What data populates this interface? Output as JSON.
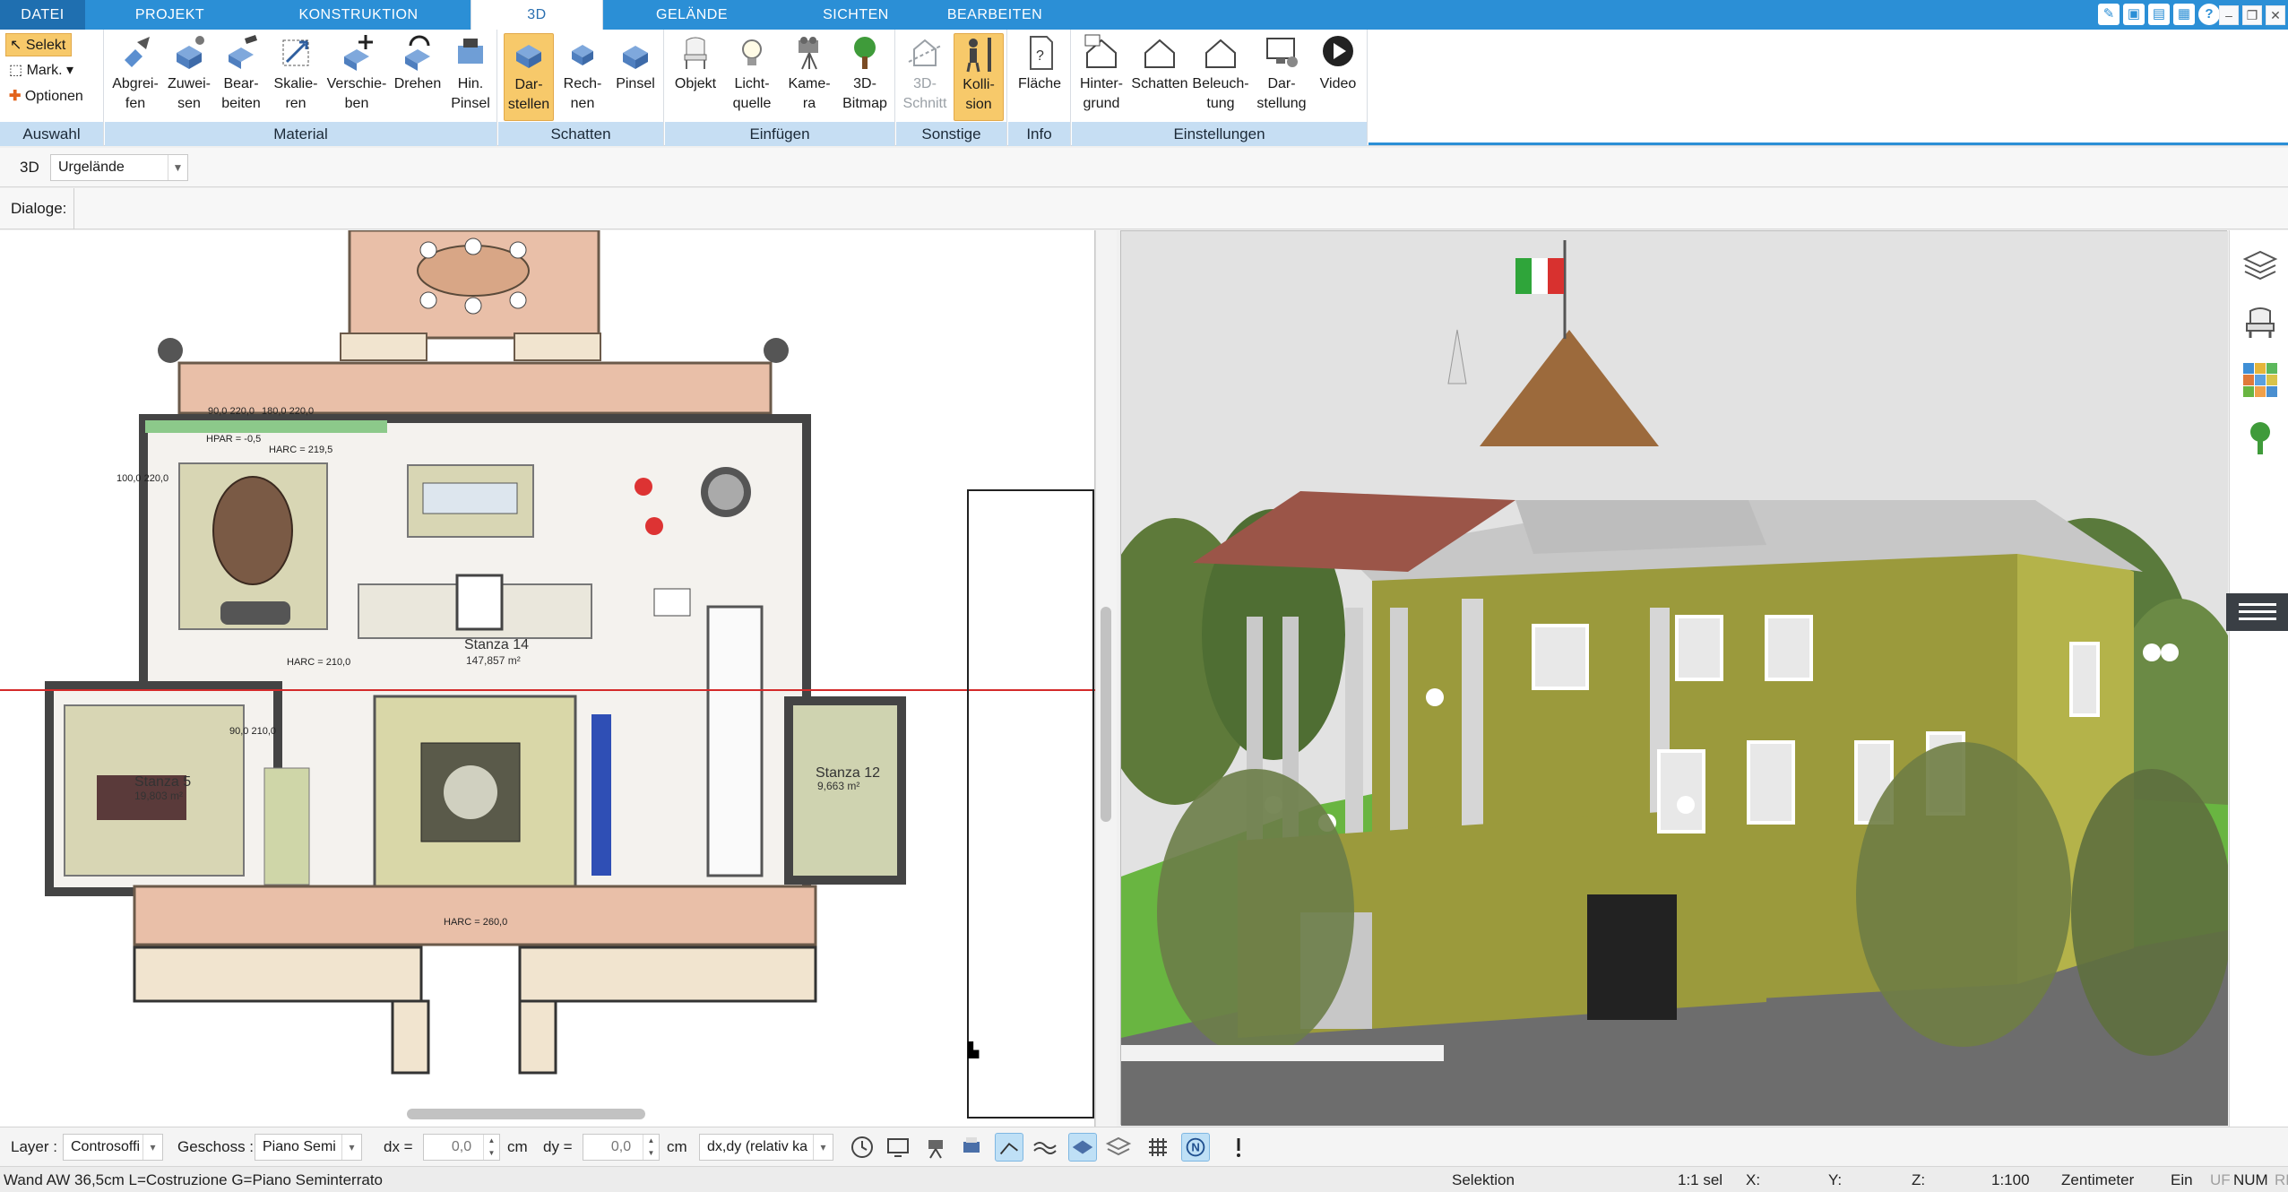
{
  "tabs": [
    "DATEI",
    "PROJEKT",
    "KONSTRUKTION",
    "3D",
    "GELÄNDE",
    "SICHTEN",
    "BEARBEITEN"
  ],
  "window_controls": [
    "minimize",
    "restore",
    "close"
  ],
  "ribbon": {
    "auswahl": {
      "label": "Auswahl",
      "selekt": "Selekt",
      "mark": "Mark.",
      "optionen": "Optionen"
    },
    "material": {
      "label": "Material",
      "buttons": [
        "Abgrei-\nfen",
        "Zuwei-\nsen",
        "Bear-\nbeiten",
        "Skalie-\nren",
        "Verschie-\nben",
        "Drehen",
        "Hin.\nPinsel"
      ]
    },
    "schatten": {
      "label": "Schatten",
      "buttons": [
        "Dar-\nstellen",
        "Rech-\nnen",
        "Pinsel"
      ]
    },
    "einfuegen": {
      "label": "Einfügen",
      "buttons": [
        "Objekt",
        "Licht-\nquelle",
        "Kame-\nra",
        "3D-\nBitmap"
      ]
    },
    "sonstige": {
      "label": "Sonstige",
      "buttons": [
        "3D-\nSchnitt",
        "Kolli-\nsion"
      ]
    },
    "info": {
      "label": "Info",
      "buttons": [
        "Fläche"
      ]
    },
    "einstellungen": {
      "label": "Einstellungen",
      "buttons": [
        "Hinter-\ngrund",
        "Schatten",
        "Beleuch-\ntung",
        "Dar-\nstellung",
        "Video"
      ]
    }
  },
  "subbar": {
    "mode": "3D",
    "terrain": "Urgelände",
    "dialoge": "Dialoge:"
  },
  "floorplan": {
    "rooms": [
      {
        "name": "Stanza 14",
        "area": "147,857 m²"
      },
      {
        "name": "Stanza 5",
        "area": "19,803 m²"
      },
      {
        "name": "Stanza 12",
        "area": "9,663 m²"
      }
    ],
    "labels": [
      "HPAR = -0,5",
      "HARC = 219,5",
      "HARC = 210,0",
      "HARC = 260,0",
      "100,0\n220,0",
      "90,0\n220,0",
      "180,0\n220,0",
      "90,0\n210,0"
    ]
  },
  "bottombar": {
    "layer_label": "Layer :",
    "layer_value": "Controsoffi",
    "geschoss_label": "Geschoss :",
    "geschoss_value": "Piano Semi",
    "dx_label": "dx =",
    "dx_value": "0,0",
    "dx_unit": "cm",
    "dy_label": "dy =",
    "dy_value": "0,0",
    "dy_unit": "cm",
    "mode_value": "dx,dy (relativ ka"
  },
  "status": {
    "message": "Wand AW 36,5cm L=Costruzione G=Piano Seminterrato",
    "selection": "Selektion",
    "sel_count": "1:1 sel",
    "x": "X:",
    "y": "Y:",
    "z": "Z:",
    "scale": "1:100",
    "unit": "Zentimeter",
    "ein": "Ein",
    "uf": "UF",
    "num": "NUM",
    "rf": "RF"
  },
  "colors": {
    "accent": "#2b8fd6",
    "group_label": "#c6def3",
    "selected": "#f7c96a"
  }
}
